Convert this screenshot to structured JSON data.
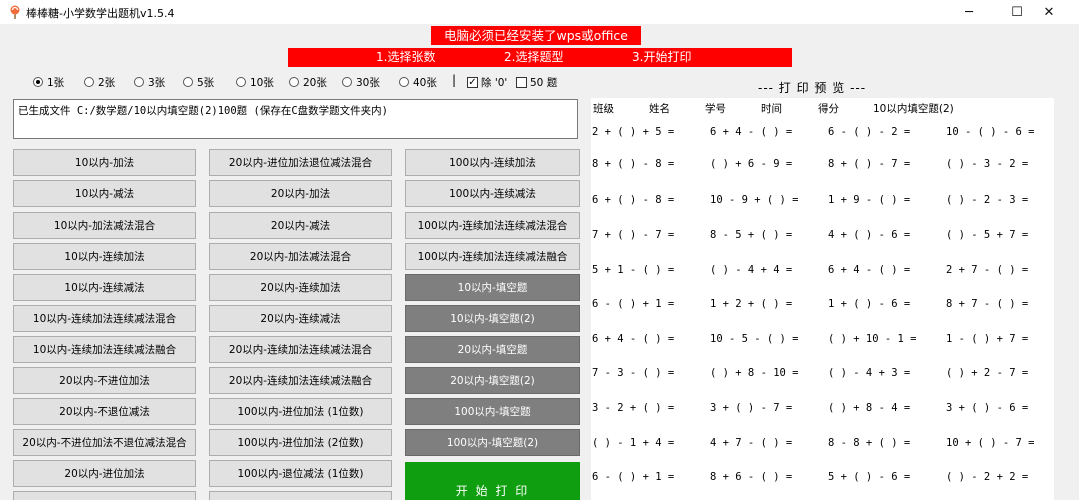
{
  "window": {
    "title": "棒棒糖-小学数学出题机v1.5.4",
    "icon": "lollipop-icon",
    "controls": [
      "─",
      "☐",
      "✕"
    ]
  },
  "banner": {
    "requirement": "电脑必须已经安装了wps或office",
    "step1": "1.选择张数",
    "step2": "2.选择题型",
    "step3": "3.开始打印"
  },
  "sheet_options": [
    {
      "label": "1张",
      "selected": true
    },
    {
      "label": "2张",
      "selected": false
    },
    {
      "label": "3张",
      "selected": false
    },
    {
      "label": "5张",
      "selected": false
    },
    {
      "label": "10张",
      "selected": false
    },
    {
      "label": "20张",
      "selected": false
    },
    {
      "label": "30张",
      "selected": false
    },
    {
      "label": "40张",
      "selected": false
    }
  ],
  "separator": "|",
  "checkboxes": [
    {
      "label": "除 '0'",
      "checked": true
    },
    {
      "label": "50 题",
      "checked": false
    }
  ],
  "check_mark": "✓",
  "status_text": "已生成文件 C:/数学题/10以内填空题(2)100题 (保存在C盘数学题文件夹内)",
  "buttons": {
    "col1": [
      "10以内-加法",
      "10以内-减法",
      "10以内-加法减法混合",
      "10以内-连续加法",
      "10以内-连续减法",
      "10以内-连续加法连续减法混合",
      "10以内-连续加法连续减法融合",
      "20以内-不进位加法",
      "20以内-不退位减法",
      "20以内-不进位加法不退位减法混合",
      "20以内-进位加法"
    ],
    "col2": [
      "20以内-进位加法退位减法混合",
      "20以内-加法",
      "20以内-减法",
      "20以内-加法减法混合",
      "20以内-连续加法",
      "20以内-连续减法",
      "20以内-连续加法连续减法混合",
      "20以内-连续加法连续减法融合",
      "100以内-进位加法 (1位数)",
      "100以内-进位加法 (2位数)",
      "100以内-退位减法 (1位数)"
    ],
    "col3": [
      "100以内-连续加法",
      "100以内-连续减法",
      "100以内-连续加法连续减法混合",
      "100以内-连续加法连续减法融合",
      "10以内-填空题",
      "10以内-填空题(2)",
      "20以内-填空题",
      "20以内-填空题(2)",
      "100以内-填空题",
      "100以内-填空题(2)"
    ],
    "print": "开 始 打 印"
  },
  "preview": {
    "title": "--- 打 印 预 览 ---",
    "header": {
      "class": "班级",
      "name": "姓名",
      "student_id": "学号",
      "time": "时间",
      "score": "得分",
      "sheet_name": "10以内填空题(2)"
    },
    "rows": [
      [
        "2 + ( ) + 5 =",
        "6 + 4 - ( ) =",
        "6 - ( ) - 2 =",
        "10 - ( ) - 6 ="
      ],
      [
        "8 + ( ) - 8 =",
        "( ) + 6 - 9 =",
        "8 + ( ) - 7 =",
        "( ) - 3 - 2 ="
      ],
      [
        "6 + ( ) - 8 =",
        "10 - 9 + ( ) =",
        "1 + 9 - ( ) =",
        "( ) - 2 - 3 ="
      ],
      [
        "7 + ( ) - 7 =",
        "8 - 5 + ( ) =",
        "4 + ( ) - 6 =",
        "( ) - 5 + 7 ="
      ],
      [
        "5 + 1 - ( ) =",
        "( ) - 4 + 4 =",
        "6 + 4 - ( ) =",
        "2 + 7 - ( ) ="
      ],
      [
        "6 - ( ) + 1 =",
        "1 + 2 + ( ) =",
        "1 + ( ) - 6 =",
        "8 + 7 - ( ) ="
      ],
      [
        "6 + 4 - ( ) =",
        "10 - 5 - ( ) =",
        "( ) + 10 - 1 =",
        "1 - ( ) + 7 ="
      ],
      [
        "7 - 3 - ( ) =",
        "( ) + 8 - 10 =",
        "( ) - 4 + 3 =",
        "( ) + 2 - 7 ="
      ],
      [
        "3 - 2 + ( ) =",
        "3 + ( ) - 7 =",
        "( ) + 8 - 4 =",
        "3 + ( ) - 6 ="
      ],
      [
        "( ) - 1 + 4 =",
        "4 + 7 - ( ) =",
        "8 - 8 + ( ) =",
        "10 + ( ) - 7 ="
      ],
      [
        "6 - ( ) + 1 =",
        "8 + 6 - ( ) =",
        "5 + ( ) - 6 =",
        "( ) - 2 + 2 ="
      ]
    ]
  }
}
